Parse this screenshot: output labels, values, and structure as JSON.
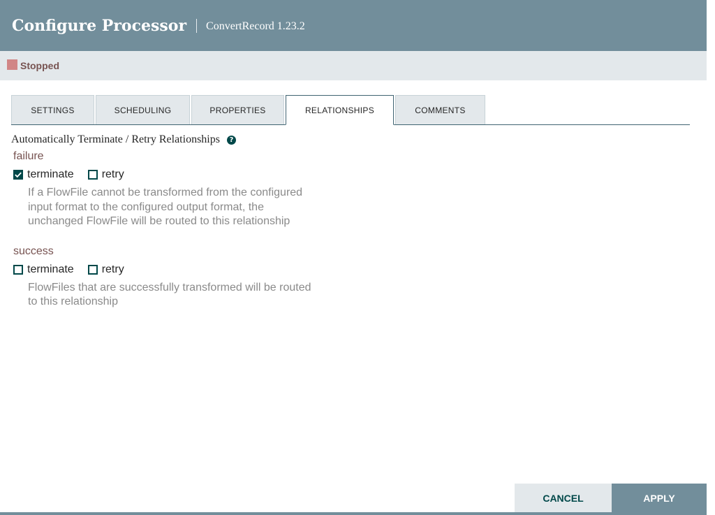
{
  "header": {
    "title": "Configure Processor",
    "subtitle": "ConvertRecord 1.23.2"
  },
  "status": {
    "text": "Stopped",
    "color": "#d18686"
  },
  "tabs": [
    {
      "label": "SETTINGS",
      "active": false
    },
    {
      "label": "SCHEDULING",
      "active": false
    },
    {
      "label": "PROPERTIES",
      "active": false
    },
    {
      "label": "RELATIONSHIPS",
      "active": true
    },
    {
      "label": "COMMENTS",
      "active": false
    }
  ],
  "relationships": {
    "section_title": "Automatically Terminate / Retry Relationships",
    "help_icon": "question-circle-icon",
    "items": [
      {
        "name": "failure",
        "terminate": {
          "label": "terminate",
          "checked": true
        },
        "retry": {
          "label": "retry",
          "checked": false
        },
        "description_lines": [
          "If a FlowFile cannot be transformed from the configured",
          "input format to the configured output format, the",
          "unchanged FlowFile will be routed to this relationship"
        ]
      },
      {
        "name": "success",
        "terminate": {
          "label": "terminate",
          "checked": false
        },
        "retry": {
          "label": "retry",
          "checked": false
        },
        "description_lines": [
          "FlowFiles that are successfully transformed will be routed",
          "to this relationship"
        ]
      }
    ]
  },
  "buttons": {
    "cancel": "CANCEL",
    "apply": "APPLY"
  },
  "colors": {
    "header": "#728e9b",
    "accent": "#004849",
    "relationship_name": "#775351"
  }
}
